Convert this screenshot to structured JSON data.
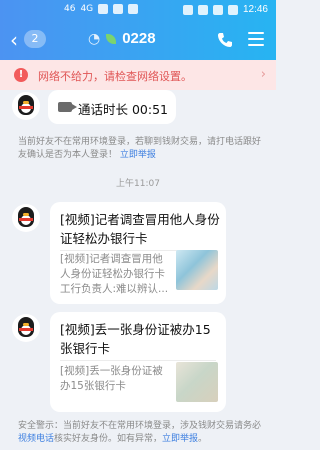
{
  "status_bar": {
    "time": "12:46",
    "signal": "46",
    "network": "4G"
  },
  "header": {
    "back_badge": "2",
    "title": "0228"
  },
  "warning": {
    "text": "网络不给力，请检查网络设置。"
  },
  "messages": {
    "call": {
      "text": "通话时长 00:51"
    },
    "notice1": {
      "text": "当前好友不在常用环境登录，若聊到钱财交易，请打电话跟好友确认是否为本人登录！",
      "link": "立即举报"
    },
    "timestamp": "上午11:07",
    "article1": {
      "title": "[视频]记者调查冒用他人身份证轻松办银行卡",
      "desc": "[视频]记者调查冒用他人身份证轻松办银行卡工行负责人:难以辨认..."
    },
    "article2": {
      "title": "[视频]丢一张身份证被办15张银行卡",
      "desc": "[视频]丢一张身份证被办15张银行卡"
    },
    "notice2": {
      "prefix": "安全警示：当前好友不在常用环境登录，涉及钱财交易请务必",
      "video_link": "视频电话",
      "middle": "核实好友身份。如有异常，",
      "link": "立即举报",
      "suffix": "。"
    }
  },
  "colors": {
    "accent": "#3d7fe0",
    "header_start": "#4c93f2",
    "header_end": "#27b4f2",
    "warning_text": "#e05555"
  }
}
